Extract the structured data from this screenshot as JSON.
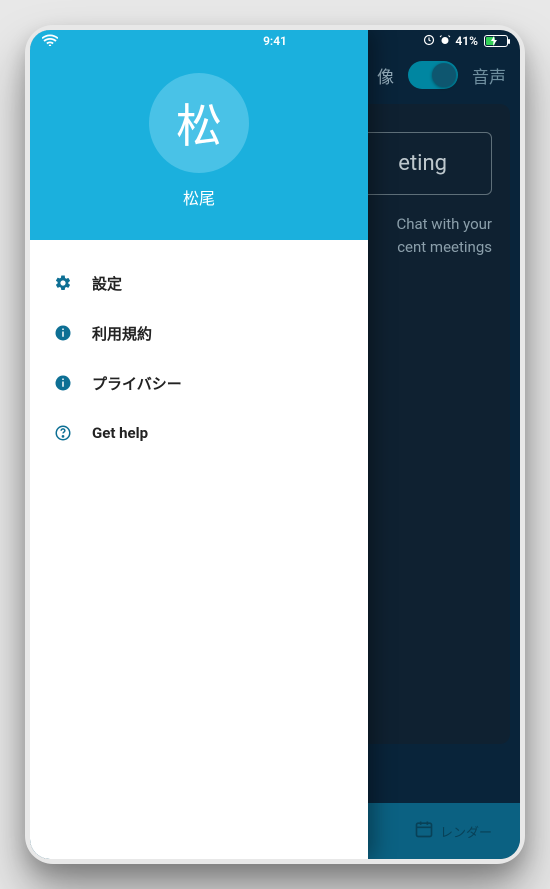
{
  "status_bar": {
    "time": "9:41",
    "battery_percent": "41%"
  },
  "drawer": {
    "avatar_initial": "松",
    "username": "松尾",
    "items": [
      {
        "icon": "gear",
        "label": "設定"
      },
      {
        "icon": "info",
        "label": "利用規約"
      },
      {
        "icon": "info",
        "label": "プライバシー"
      },
      {
        "icon": "help",
        "label": "Get help"
      }
    ]
  },
  "main": {
    "video_label_partial": "像",
    "audio_label": "音声",
    "meeting_button_partial": "eting",
    "hint_line1_partial": "Chat with your",
    "hint_line2_partial": "cent meetings"
  },
  "bottom_nav": {
    "calendar_label_partial": "レンダー"
  }
}
